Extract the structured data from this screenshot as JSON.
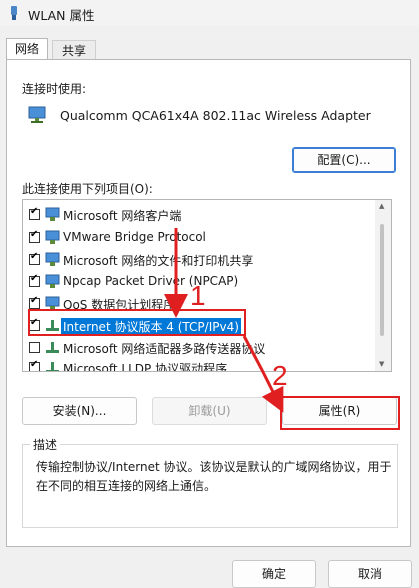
{
  "window": {
    "title": "WLAN 属性"
  },
  "tabs": [
    {
      "label": "网络",
      "active": true
    },
    {
      "label": "共享",
      "active": false
    }
  ],
  "connect_using": {
    "label": "连接时使用:",
    "adapter": "Qualcomm QCA61x4A 802.11ac Wireless Adapter",
    "configure_button": "配置(C)..."
  },
  "items_label": "此连接使用下列项目(O):",
  "items": [
    {
      "label": "Microsoft 网络客户端",
      "checked": true,
      "icon": "network-client-icon",
      "selected": false
    },
    {
      "label": "VMware Bridge Protocol",
      "checked": true,
      "icon": "network-service-icon",
      "selected": false
    },
    {
      "label": "Microsoft 网络的文件和打印机共享",
      "checked": true,
      "icon": "network-service-icon",
      "selected": false
    },
    {
      "label": "Npcap Packet Driver (NPCAP)",
      "checked": true,
      "icon": "network-service-icon",
      "selected": false
    },
    {
      "label": "QoS 数据包计划程序",
      "checked": true,
      "icon": "network-service-icon",
      "selected": false
    },
    {
      "label": "Internet 协议版本 4 (TCP/IPv4)",
      "checked": true,
      "icon": "protocol-icon",
      "selected": true
    },
    {
      "label": "Microsoft 网络适配器多路传送器协议",
      "checked": false,
      "icon": "protocol-icon",
      "selected": false
    },
    {
      "label": "Microsoft LLDP 协议驱动程序",
      "checked": true,
      "icon": "protocol-icon",
      "selected": false
    }
  ],
  "buttons": {
    "install": "安装(N)...",
    "uninstall": "卸载(U)",
    "properties": "属性(R)",
    "ok": "确定",
    "cancel": "取消"
  },
  "description": {
    "title": "描述",
    "text": "传输控制协议/Internet 协议。该协议是默认的广域网络协议，用于在不同的相互连接的网络上通信。"
  },
  "annotations": {
    "step1": "1",
    "step2": "2",
    "color": "#e02020"
  },
  "colors": {
    "selection": "#0078d7",
    "accent": "#3c7ed4"
  }
}
